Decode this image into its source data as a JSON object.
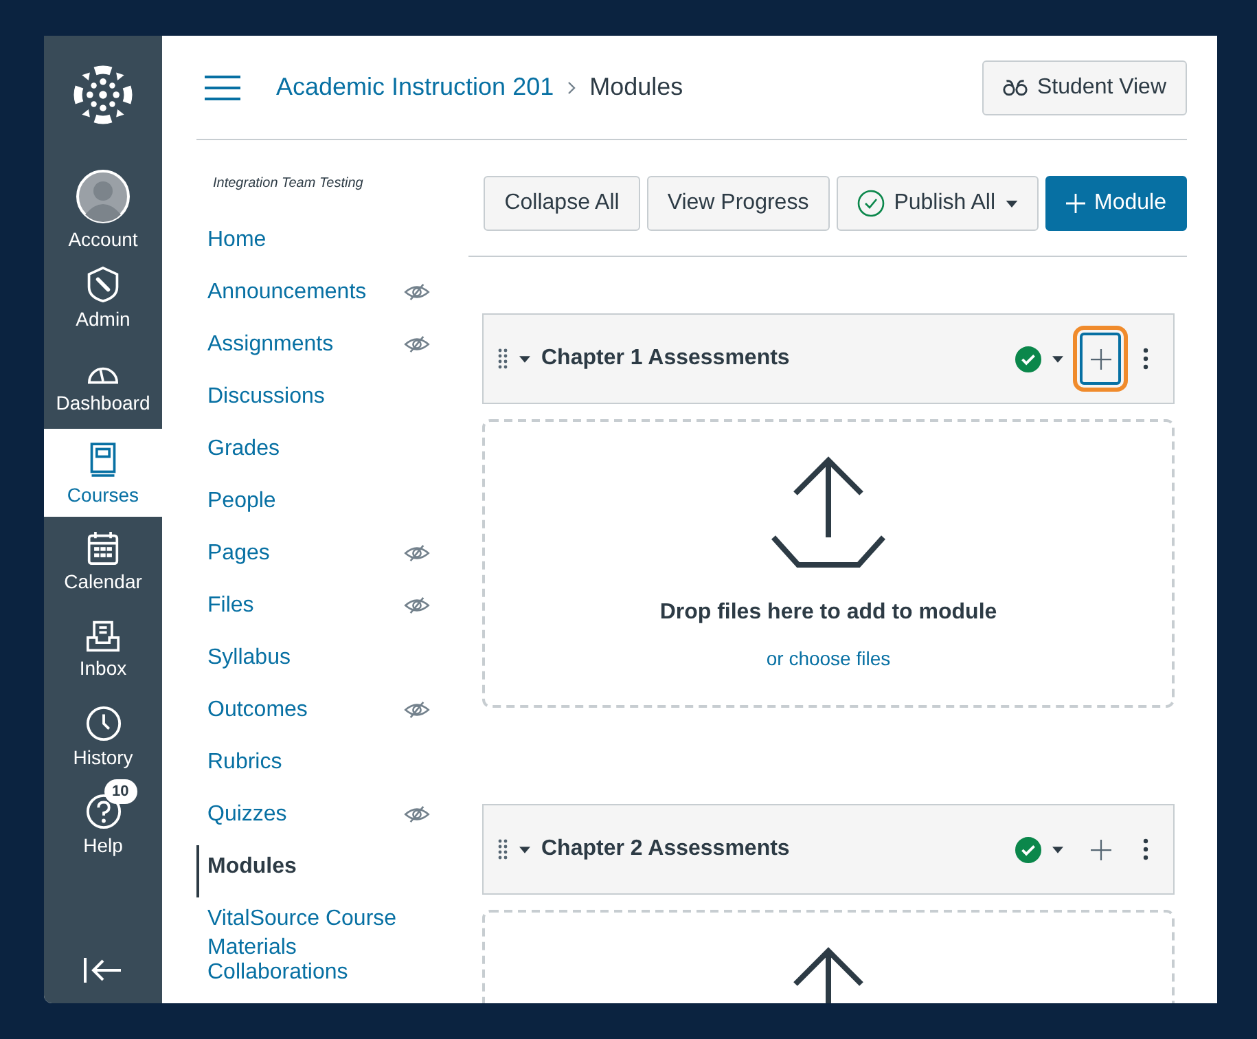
{
  "global_nav": [
    {
      "kind": "account",
      "label": "Account",
      "selected": false
    },
    {
      "kind": "admin",
      "label": "Admin",
      "selected": false
    },
    {
      "kind": "dashboard",
      "label": "Dashboard",
      "selected": false
    },
    {
      "kind": "courses",
      "label": "Courses",
      "selected": true
    },
    {
      "kind": "calendar",
      "label": "Calendar",
      "selected": false
    },
    {
      "kind": "inbox",
      "label": "Inbox",
      "selected": false
    },
    {
      "kind": "history",
      "label": "History",
      "selected": false
    },
    {
      "kind": "help",
      "label": "Help",
      "selected": false,
      "badge": "10"
    }
  ],
  "breadcrumb": {
    "course": "Academic Instruction 201",
    "current": "Modules"
  },
  "student_view_button": "Student View",
  "course_nav": {
    "term": "Integration Team Testing",
    "items": [
      {
        "label": "Home",
        "hidden": false,
        "selected": false
      },
      {
        "label": "Announcements",
        "hidden": true,
        "selected": false
      },
      {
        "label": "Assignments",
        "hidden": true,
        "selected": false
      },
      {
        "label": "Discussions",
        "hidden": false,
        "selected": false
      },
      {
        "label": "Grades",
        "hidden": false,
        "selected": false
      },
      {
        "label": "People",
        "hidden": false,
        "selected": false
      },
      {
        "label": "Pages",
        "hidden": true,
        "selected": false
      },
      {
        "label": "Files",
        "hidden": true,
        "selected": false
      },
      {
        "label": "Syllabus",
        "hidden": false,
        "selected": false
      },
      {
        "label": "Outcomes",
        "hidden": true,
        "selected": false
      },
      {
        "label": "Rubrics",
        "hidden": false,
        "selected": false
      },
      {
        "label": "Quizzes",
        "hidden": true,
        "selected": false
      },
      {
        "label": "Modules",
        "hidden": false,
        "selected": true
      },
      {
        "label": "VitalSource Course Materials",
        "hidden": false,
        "selected": false
      },
      {
        "label": "Collaborations",
        "hidden": false,
        "selected": false
      }
    ]
  },
  "toolbar": {
    "collapse_all": "Collapse All",
    "view_progress": "View Progress",
    "publish_all": "Publish All",
    "add_module": "Module"
  },
  "modules": [
    {
      "title": "Chapter 1 Assessments",
      "published": true,
      "add_focused": true,
      "dropzone": {
        "title": "Drop files here to add to module",
        "link": "or choose files"
      }
    },
    {
      "title": "Chapter 2 Assessments",
      "published": true,
      "add_focused": false
    }
  ]
}
